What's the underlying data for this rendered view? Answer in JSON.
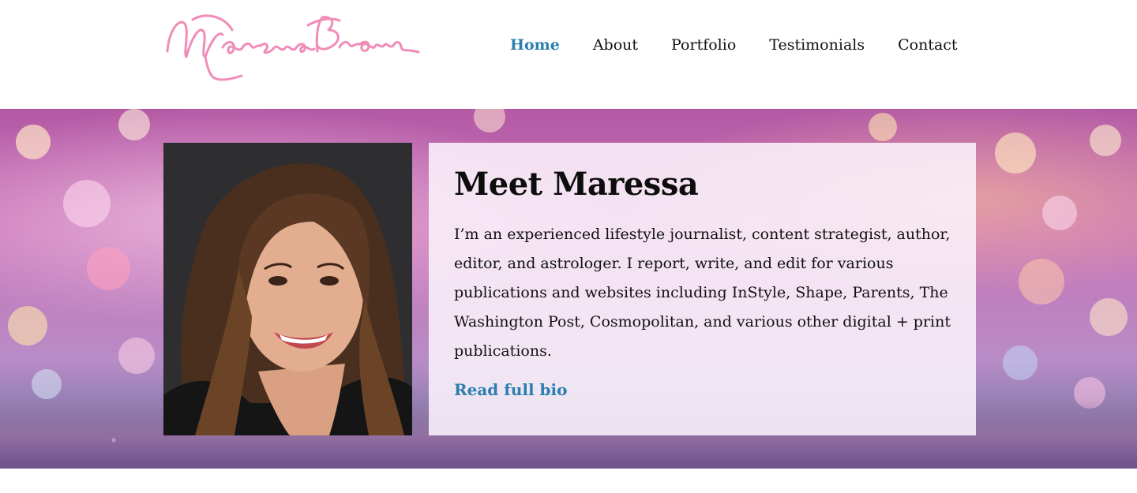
{
  "logo": {
    "text": "Maressa Brown",
    "color": "#f08cb8"
  },
  "nav": {
    "items": [
      {
        "label": "Home",
        "active": true
      },
      {
        "label": "About"
      },
      {
        "label": "Portfolio"
      },
      {
        "label": "Testimonials"
      },
      {
        "label": "Contact"
      }
    ],
    "active_color": "#2b7fae"
  },
  "hero": {
    "title": "Meet Maressa",
    "body": "I’m an experienced lifestyle journalist, content strategist, author, editor, and astrologer. I report, write, and edit for various publications and websites including InStyle, Shape, Parents, The Washington Post, Cosmopolitan, and various other digital + print publications.",
    "link_label": "Read full bio",
    "link_color": "#2b7fae"
  }
}
